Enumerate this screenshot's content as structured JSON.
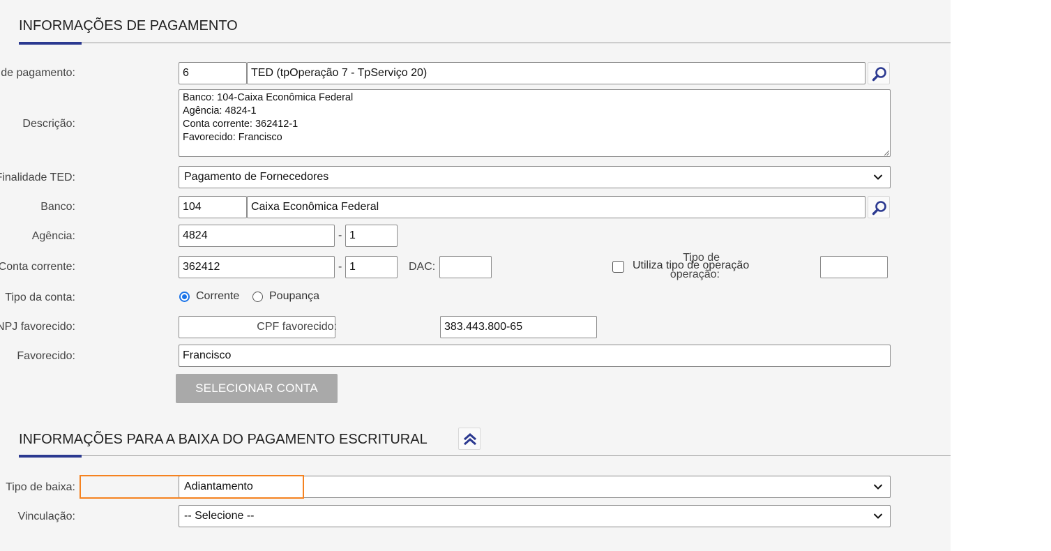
{
  "section_payment": {
    "title": "INFORMAÇÕES DE PAGAMENTO"
  },
  "fields": {
    "forma_pagamento": {
      "label": "Forma de pagamento:",
      "code": "6",
      "name": "TED (tpOperação 7 - TpServiço 20)"
    },
    "descricao": {
      "label": "Descrição:",
      "lines": [
        "Banco: 104-Caixa Econômica Federal",
        "Agência: 4824-1",
        "Conta corrente: 362412-1",
        "Favorecido: Francisco"
      ]
    },
    "finalidade_ted": {
      "label": "Finalidade TED:",
      "value": "Pagamento de Fornecedores"
    },
    "banco": {
      "label": "Banco:",
      "code": "104",
      "name": "Caixa Econômica Federal"
    },
    "agencia": {
      "label": "Agência:",
      "value": "4824",
      "dash": "-",
      "digit": "1"
    },
    "conta_corrente": {
      "label": "Conta corrente:",
      "value": "362412",
      "dash": "-",
      "digit": "1",
      "dac_label": "DAC:",
      "dac_value": ""
    },
    "utiliza_tipo_operacao": {
      "label": "Utiliza tipo de operação",
      "checked": false
    },
    "tipo_operacao": {
      "label_line1": "Tipo de",
      "label_line2": "operação:",
      "value": ""
    },
    "tipo_conta": {
      "label": "Tipo da conta:",
      "options": [
        "Corrente",
        "Poupança"
      ],
      "selected": "Corrente"
    },
    "cnpj_favorecido": {
      "label": "CNPJ favorecido:",
      "value": ""
    },
    "cpf_favorecido": {
      "label": "CPF favorecido:",
      "value": "383.443.800-65"
    },
    "favorecido": {
      "label": "Favorecido:",
      "value": "Francisco"
    }
  },
  "buttons": {
    "selecionar_conta": "SELECIONAR CONTA"
  },
  "section_baixa": {
    "title": "INFORMAÇÕES PARA A BAIXA DO PAGAMENTO ESCRITURAL"
  },
  "baixa": {
    "tipo_baixa": {
      "label": "Tipo de baixa:",
      "value": "Adiantamento"
    },
    "vinculacao": {
      "label": "Vinculação:",
      "value": "-- Selecione --"
    }
  },
  "colors": {
    "accent": "#2b3990",
    "highlight": "#f5821f",
    "radio": "#1a73e8",
    "button_disabled": "#a9a9a9"
  },
  "icons": {
    "search": "search-icon",
    "collapse": "double-chevron-up-icon",
    "dropdown": "chevron-down-icon"
  }
}
